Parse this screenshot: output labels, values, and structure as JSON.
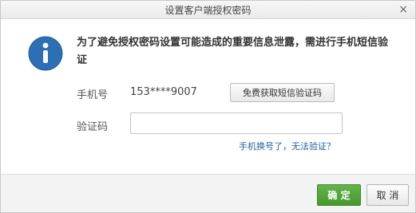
{
  "dialog": {
    "title": "设置客户端授权密码",
    "close_glyph": "×"
  },
  "message": "为了避免授权密码设置可能造成的重要信息泄露，需进行手机短信验证",
  "info_icon": {
    "name": "info-icon",
    "glyph": "i",
    "color": "#2c6fb5"
  },
  "phone": {
    "label": "手机号",
    "value": "153****9007",
    "send_code_label": "免费获取短信验证码"
  },
  "code": {
    "label": "验证码",
    "value": "",
    "placeholder": ""
  },
  "help_link": "手机换号了，无法验证？",
  "footer": {
    "ok_label": "确 定",
    "cancel_label": "取 消"
  },
  "colors": {
    "accent_ok": "#4fa636",
    "link": "#1f5f9f",
    "icon_blue": "#2c6fb5"
  }
}
